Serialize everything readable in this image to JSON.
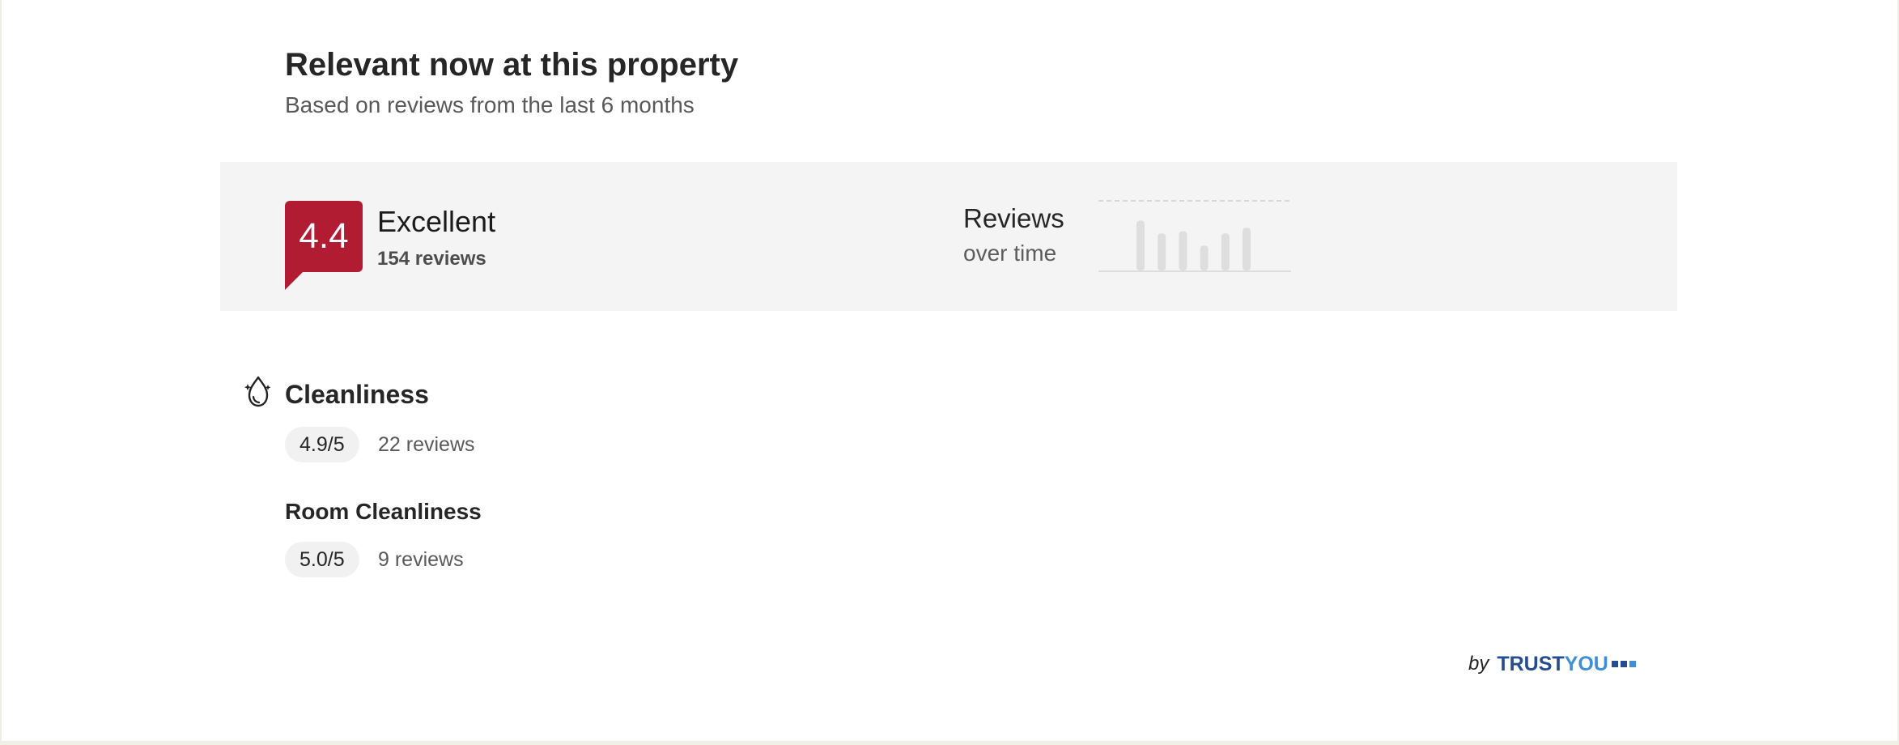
{
  "header": {
    "title": "Relevant now at this property",
    "subtitle": "Based on reviews from the last 6 months"
  },
  "summary": {
    "score": "4.4",
    "rating_label": "Excellent",
    "review_count": "154 reviews",
    "trend_title": "Reviews",
    "trend_subtitle": "over time",
    "accent_color": "#b11c32"
  },
  "trend": {
    "bars": [
      0.7,
      0.52,
      0.55,
      0.35,
      0.52,
      0.6
    ]
  },
  "categories": [
    {
      "title": "Cleanliness",
      "icon": "sparkle-drop-icon",
      "score": "4.9/5",
      "reviews": "22 reviews"
    },
    {
      "title": "Room Cleanliness",
      "score": "5.0/5",
      "reviews": "9 reviews"
    }
  ],
  "footer": {
    "by_label": "by",
    "brand_part_1": "TRUST",
    "brand_part_2": "YOU",
    "brand_mark": "trustyou-logo-mark"
  }
}
